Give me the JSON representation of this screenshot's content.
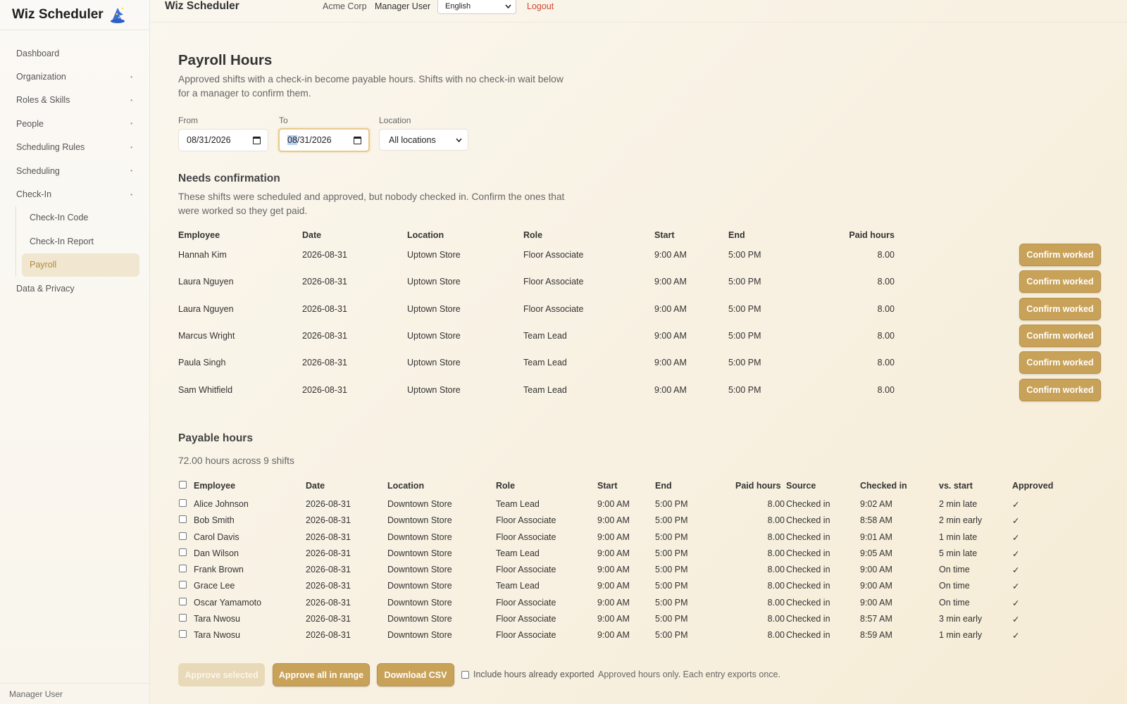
{
  "sidebar": {
    "brand": "Wiz Scheduler",
    "brand_icon": "wizard-hat-icon",
    "items": [
      {
        "label": "Dashboard",
        "chevron": false
      },
      {
        "label": "Organization",
        "chevron": true
      },
      {
        "label": "Roles & Skills",
        "chevron": true
      },
      {
        "label": "People",
        "chevron": true
      },
      {
        "label": "Scheduling Rules",
        "chevron": true
      },
      {
        "label": "Scheduling",
        "chevron": true
      },
      {
        "label": "Check-In",
        "chevron": true
      }
    ],
    "checkin_children": [
      {
        "label": "Check-In Code"
      },
      {
        "label": "Check-In Report"
      },
      {
        "label": "Payroll",
        "active": true
      }
    ],
    "data_privacy": "Data & Privacy",
    "footer_user": "Manager User"
  },
  "topbar": {
    "title": "Wiz Scheduler",
    "org": "Acme Corp",
    "user": "Manager User",
    "language": "English",
    "logout": "Logout"
  },
  "page": {
    "title": "Payroll Hours",
    "intro": "Approved shifts with a check-in become payable hours. Shifts with no check-in wait below for a manager to confirm them."
  },
  "filters": {
    "from_label": "From",
    "from_value": "08/31/2026",
    "to_label": "To",
    "to_value_highlight": "08",
    "to_value_rest": "/31/2026",
    "location_label": "Location",
    "location_value": "All locations"
  },
  "needs_confirmation": {
    "title": "Needs confirmation",
    "description": "These shifts were scheduled and approved, but nobody checked in. Confirm the ones that were worked so they get paid.",
    "columns": [
      "Employee",
      "Date",
      "Location",
      "Role",
      "Start",
      "End",
      "Paid hours"
    ],
    "button_label": "Confirm worked",
    "rows": [
      {
        "employee": "Hannah Kim",
        "date": "2026-08-31",
        "location": "Uptown Store",
        "role": "Floor Associate",
        "start": "9:00 AM",
        "end": "5:00 PM",
        "paid": "8.00"
      },
      {
        "employee": "Laura Nguyen",
        "date": "2026-08-31",
        "location": "Uptown Store",
        "role": "Floor Associate",
        "start": "9:00 AM",
        "end": "5:00 PM",
        "paid": "8.00"
      },
      {
        "employee": "Laura Nguyen",
        "date": "2026-08-31",
        "location": "Uptown Store",
        "role": "Floor Associate",
        "start": "9:00 AM",
        "end": "5:00 PM",
        "paid": "8.00"
      },
      {
        "employee": "Marcus Wright",
        "date": "2026-08-31",
        "location": "Uptown Store",
        "role": "Team Lead",
        "start": "9:00 AM",
        "end": "5:00 PM",
        "paid": "8.00"
      },
      {
        "employee": "Paula Singh",
        "date": "2026-08-31",
        "location": "Uptown Store",
        "role": "Team Lead",
        "start": "9:00 AM",
        "end": "5:00 PM",
        "paid": "8.00"
      },
      {
        "employee": "Sam Whitfield",
        "date": "2026-08-31",
        "location": "Uptown Store",
        "role": "Team Lead",
        "start": "9:00 AM",
        "end": "5:00 PM",
        "paid": "8.00"
      }
    ]
  },
  "payable": {
    "title": "Payable hours",
    "summary": "72.00 hours across 9 shifts",
    "columns": [
      "Employee",
      "Date",
      "Location",
      "Role",
      "Start",
      "End",
      "Paid hours",
      "Source",
      "Checked in",
      "vs. start",
      "Approved"
    ],
    "rows": [
      {
        "employee": "Alice Johnson",
        "date": "2026-08-31",
        "location": "Downtown Store",
        "role": "Team Lead",
        "start": "9:00 AM",
        "end": "5:00 PM",
        "paid": "8.00",
        "source": "Checked in",
        "checked_in": "9:02 AM",
        "vs_start": "2 min late",
        "approved": "✓"
      },
      {
        "employee": "Bob Smith",
        "date": "2026-08-31",
        "location": "Downtown Store",
        "role": "Floor Associate",
        "start": "9:00 AM",
        "end": "5:00 PM",
        "paid": "8.00",
        "source": "Checked in",
        "checked_in": "8:58 AM",
        "vs_start": "2 min early",
        "approved": "✓"
      },
      {
        "employee": "Carol Davis",
        "date": "2026-08-31",
        "location": "Downtown Store",
        "role": "Floor Associate",
        "start": "9:00 AM",
        "end": "5:00 PM",
        "paid": "8.00",
        "source": "Checked in",
        "checked_in": "9:01 AM",
        "vs_start": "1 min late",
        "approved": "✓"
      },
      {
        "employee": "Dan Wilson",
        "date": "2026-08-31",
        "location": "Downtown Store",
        "role": "Team Lead",
        "start": "9:00 AM",
        "end": "5:00 PM",
        "paid": "8.00",
        "source": "Checked in",
        "checked_in": "9:05 AM",
        "vs_start": "5 min late",
        "approved": "✓"
      },
      {
        "employee": "Frank Brown",
        "date": "2026-08-31",
        "location": "Downtown Store",
        "role": "Floor Associate",
        "start": "9:00 AM",
        "end": "5:00 PM",
        "paid": "8.00",
        "source": "Checked in",
        "checked_in": "9:00 AM",
        "vs_start": "On time",
        "approved": "✓"
      },
      {
        "employee": "Grace Lee",
        "date": "2026-08-31",
        "location": "Downtown Store",
        "role": "Team Lead",
        "start": "9:00 AM",
        "end": "5:00 PM",
        "paid": "8.00",
        "source": "Checked in",
        "checked_in": "9:00 AM",
        "vs_start": "On time",
        "approved": "✓"
      },
      {
        "employee": "Oscar Yamamoto",
        "date": "2026-08-31",
        "location": "Downtown Store",
        "role": "Floor Associate",
        "start": "9:00 AM",
        "end": "5:00 PM",
        "paid": "8.00",
        "source": "Checked in",
        "checked_in": "9:00 AM",
        "vs_start": "On time",
        "approved": "✓"
      },
      {
        "employee": "Tara Nwosu",
        "date": "2026-08-31",
        "location": "Downtown Store",
        "role": "Floor Associate",
        "start": "9:00 AM",
        "end": "5:00 PM",
        "paid": "8.00",
        "source": "Checked in",
        "checked_in": "8:57 AM",
        "vs_start": "3 min early",
        "approved": "✓"
      },
      {
        "employee": "Tara Nwosu",
        "date": "2026-08-31",
        "location": "Downtown Store",
        "role": "Floor Associate",
        "start": "9:00 AM",
        "end": "5:00 PM",
        "paid": "8.00",
        "source": "Checked in",
        "checked_in": "8:59 AM",
        "vs_start": "1 min early",
        "approved": "✓"
      }
    ]
  },
  "actions": {
    "approve_selected": "Approve selected",
    "approve_all": "Approve all in range",
    "download_csv": "Download CSV",
    "include_exported": "Include hours already exported",
    "note": "Approved hours only. Each entry exports once."
  },
  "colors": {
    "accent": "#c9a25a",
    "logout": "#d04a35",
    "active_nav_bg": "#f1e6cf",
    "active_nav_text": "#b48a3c"
  }
}
